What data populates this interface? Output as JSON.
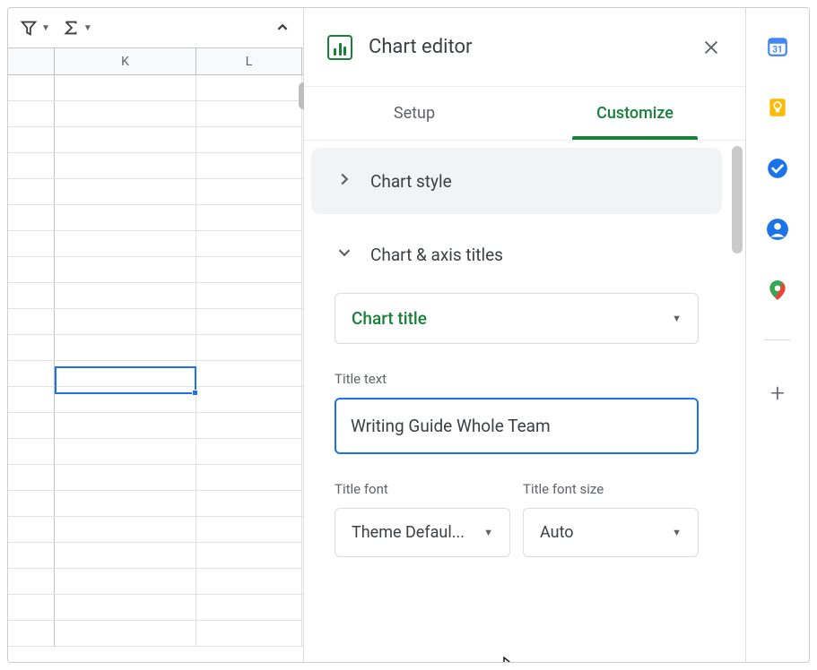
{
  "toolbar": {
    "filter_icon": "filter",
    "sigma_icon": "sigma"
  },
  "columns": {
    "k": "K",
    "l": "L"
  },
  "editor": {
    "title": "Chart editor",
    "tabs": {
      "setup": "Setup",
      "customize": "Customize"
    },
    "sections": {
      "chart_style": "Chart style",
      "chart_axis": "Chart & axis titles"
    },
    "chart_title_dropdown": "Chart title",
    "title_text_label": "Title text",
    "title_text_value": "Writing Guide Whole Team",
    "title_font_label": "Title font",
    "title_font_value": "Theme Defaul...",
    "title_font_size_label": "Title font size",
    "title_font_size_value": "Auto"
  },
  "rail": {
    "calendar": "calendar",
    "keep": "keep",
    "tasks": "tasks",
    "contacts": "contacts",
    "maps": "maps"
  }
}
